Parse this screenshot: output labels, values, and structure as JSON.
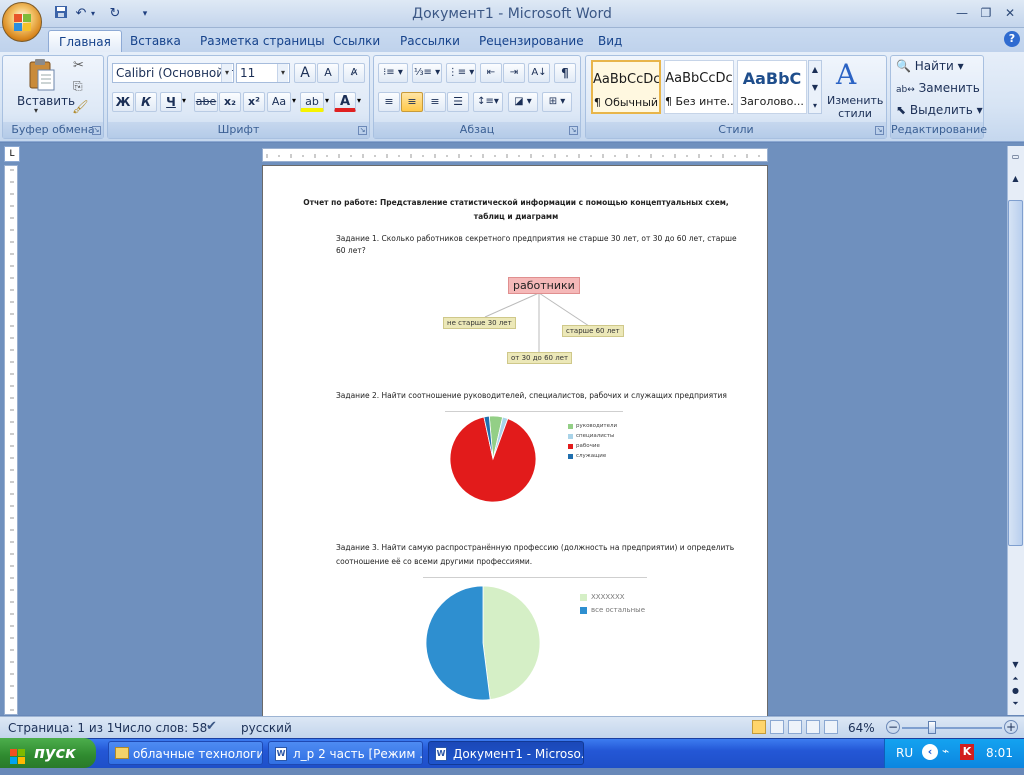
{
  "window": {
    "title": "Документ1 - Microsoft Word"
  },
  "qat": {
    "save_icon": "save-icon",
    "undo_icon": "undo-icon",
    "redo_icon": "redo-icon"
  },
  "tabs": [
    "Главная",
    "Вставка",
    "Разметка страницы",
    "Ссылки",
    "Рассылки",
    "Рецензирование",
    "Вид"
  ],
  "ribbon": {
    "clipboard": {
      "label": "Буфер обмена",
      "paste": "Вставить"
    },
    "font": {
      "label": "Шрифт",
      "name": "Calibri (Основной те",
      "size": "11",
      "bold": "Ж",
      "italic": "К",
      "underline": "Ч",
      "strike": "abe",
      "sub": "x₂",
      "sup": "x²",
      "case": "Aa",
      "grow": "A",
      "shrink": "A"
    },
    "paragraph": {
      "label": "Абзац",
      "pilcrow": "¶"
    },
    "styles": {
      "label": "Стили",
      "cards": [
        {
          "preview": "AaBbCcDc",
          "name": "¶ Обычный"
        },
        {
          "preview": "AaBbCcDc",
          "name": "¶ Без инте..."
        },
        {
          "preview": "AaBbC",
          "name": "Заголово..."
        }
      ],
      "change": "Изменить стили"
    },
    "editing": {
      "label": "Редактирование",
      "find": "Найти",
      "replace": "Заменить",
      "select": "Выделить"
    }
  },
  "document": {
    "title_line1": "Отчет по работе: Представление статистической информации  с помощью  концептуальных  схем,",
    "title_line2": "таблиц и диаграмм",
    "task1": "Задание 1. Сколько работников секретного предприятия не старше 30 лет, от 30 до 60 лет, старше",
    "task1_cont": "60 лет?",
    "mindmap": {
      "root": "работники",
      "nodes": [
        "не старше 30 лет",
        "старше 60 лет",
        "от 30 до 60 лет"
      ]
    },
    "task2": "Задание 2. Найти соотношение руководителей, специалистов, рабочих и служащих предприятия",
    "task3_line1": "Задание 3. Найти самую распространённую профессию (должность на предприятии) и определить",
    "task3_line2": "соотношение её со всеми другими профессиями."
  },
  "chart_data": [
    {
      "type": "pie",
      "title": "",
      "legend_position": "right",
      "categories": [
        "руководители",
        "специалисты",
        "рабочие",
        "служащие"
      ],
      "values": [
        5,
        2,
        91,
        2
      ],
      "colors": [
        "#93cf86",
        "#a9d3e8",
        "#e21b1b",
        "#1f6fae"
      ]
    },
    {
      "type": "pie",
      "title": "",
      "legend_position": "right",
      "categories": [
        "XXXXXXX",
        "все остальные"
      ],
      "values": [
        48,
        52
      ],
      "colors": [
        "#d5efc6",
        "#2e8fd0"
      ]
    }
  ],
  "status": {
    "page": "Страница: 1 из 1",
    "words": "Число слов: 58",
    "lang": "русский",
    "zoom": "64%"
  },
  "taskbar": {
    "start": "пуск",
    "items": [
      "облачные технологии",
      "л_р 2 часть [Режим ...",
      "Документ1 - Microso..."
    ],
    "lang": "RU",
    "time": "8:01"
  }
}
